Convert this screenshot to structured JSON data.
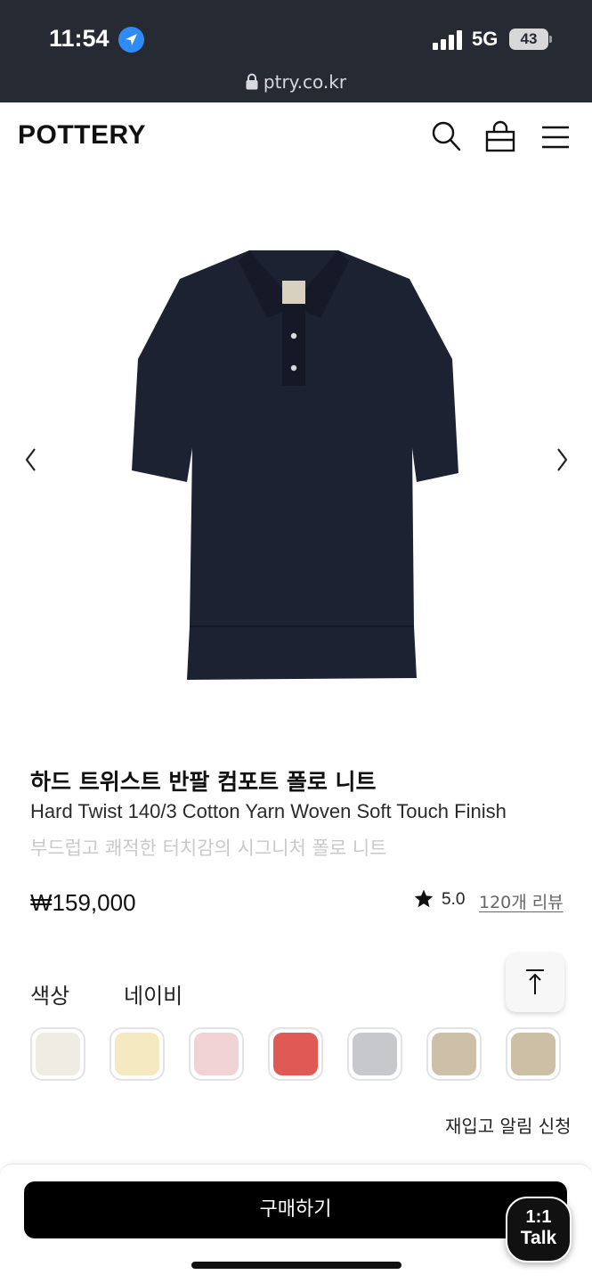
{
  "status_bar": {
    "time": "11:54",
    "network": "5G",
    "battery": "43",
    "url": "ptry.co.kr"
  },
  "header": {
    "logo": "POTTERY",
    "icons": [
      "search-icon",
      "shopping-bag-icon",
      "menu-icon"
    ]
  },
  "product": {
    "name_ko": "하드 트위스트 반팔 컴포트 폴로 니트",
    "name_en": "Hard Twist 140/3 Cotton Yarn Woven Soft Touch Finish",
    "tagline": "부드럽고 쾌적한 터치감의 시그니처 폴로 니트",
    "price": "₩159,000",
    "rating": "5.0",
    "reviews": "120개 리뷰",
    "image_color": "#1d2233"
  },
  "colors": {
    "label": "색상",
    "selected": "네이비",
    "swatches": [
      "#efece3",
      "#f4e9c1",
      "#f1d3d6",
      "#e05a55",
      "#c7c8cc",
      "#cdbfa8",
      "#cdbfa6"
    ]
  },
  "restock": "재입고 알림 신청",
  "bottom": {
    "buy_label": "구매하기",
    "talk_line1": "1:1",
    "talk_line2": "Talk"
  }
}
